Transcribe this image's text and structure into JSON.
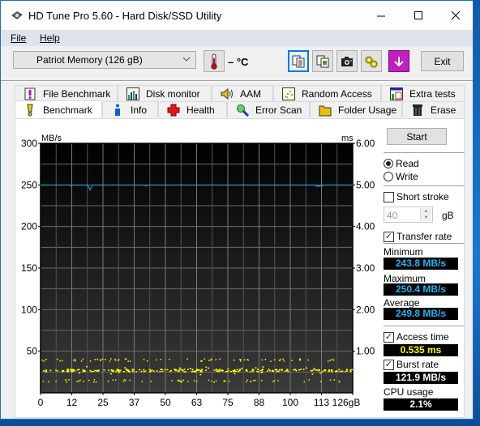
{
  "window": {
    "title": "HD Tune Pro 5.60 - Hard Disk/SSD Utility",
    "controls": {
      "minimize": "minimize-icon",
      "maximize": "maximize-icon",
      "close": "close-icon"
    }
  },
  "menu": [
    {
      "label": "File",
      "accel": "F"
    },
    {
      "label": "Help",
      "accel": "H"
    }
  ],
  "toolbar": {
    "drive": "Patriot Memory (126 gB)",
    "temperature": "– °C",
    "buttons": [
      {
        "name": "copy-text-button",
        "icon": "copy-text-icon"
      },
      {
        "name": "copy-screenshot-button",
        "icon": "copy-image-icon"
      },
      {
        "name": "screenshot-button",
        "icon": "camera-icon"
      },
      {
        "name": "options-button",
        "icon": "gears-icon"
      },
      {
        "name": "save-button",
        "icon": "download-arrow-icon"
      }
    ],
    "exit_label": "Exit"
  },
  "tabs": {
    "top": [
      {
        "label": "File Benchmark",
        "icon": "file-benchmark-icon"
      },
      {
        "label": "Disk monitor",
        "icon": "disk-monitor-icon"
      },
      {
        "label": "AAM",
        "icon": "speaker-icon"
      },
      {
        "label": "Random Access",
        "icon": "random-access-icon"
      },
      {
        "label": "Extra tests",
        "icon": "extra-tests-icon"
      }
    ],
    "bottom": [
      {
        "label": "Benchmark",
        "icon": "exclamation-icon",
        "active": true
      },
      {
        "label": "Info",
        "icon": "info-icon"
      },
      {
        "label": "Health",
        "icon": "health-cross-icon"
      },
      {
        "label": "Error Scan",
        "icon": "magnifier-icon"
      },
      {
        "label": "Folder Usage",
        "icon": "folder-icon"
      },
      {
        "label": "Erase",
        "icon": "trash-icon"
      }
    ]
  },
  "side": {
    "start_label": "Start",
    "read_label": "Read",
    "write_label": "Write",
    "mode": "read",
    "short_stroke_label": "Short stroke",
    "short_stroke_checked": false,
    "short_stroke_value": "40",
    "short_stroke_unit": "gB",
    "transfer_rate_label": "Transfer rate",
    "transfer_rate_checked": true,
    "minimum_label": "Minimum",
    "minimum_value": "243.8 MB/s",
    "maximum_label": "Maximum",
    "maximum_value": "250.4 MB/s",
    "average_label": "Average",
    "average_value": "249.8 MB/s",
    "access_time_label": "Access time",
    "access_time_checked": true,
    "access_time_value": "0.535 ms",
    "burst_rate_label": "Burst rate",
    "burst_rate_checked": true,
    "burst_rate_value": "121.9 MB/s",
    "cpu_label": "CPU usage",
    "cpu_value": "2.1%"
  },
  "colors": {
    "transfer_line": "#1fa8e8",
    "access_dots": "#ffff00",
    "readout_blue": "#1fb4f0"
  },
  "chart_data": {
    "type": "line",
    "title": "",
    "left_unit": "MB/s",
    "right_unit": "ms",
    "xlabel": "gB",
    "x_range": [
      0,
      126
    ],
    "x_ticks": [
      "0",
      "12",
      "25",
      "37",
      "50",
      "63",
      "75",
      "88",
      "100",
      "113",
      "126gB"
    ],
    "y_left_range": [
      0,
      300
    ],
    "y_left_ticks": [
      "50",
      "100",
      "150",
      "200",
      "250",
      "300"
    ],
    "y_right_range": [
      0,
      6
    ],
    "y_right_ticks": [
      "1.00",
      "2.00",
      "3.00",
      "4.00",
      "5.00",
      "6.00"
    ],
    "grid": true,
    "series": [
      {
        "name": "Transfer rate",
        "axis": "left",
        "x": [
          0,
          12,
          12.5,
          13,
          19,
          19.5,
          20,
          20.5,
          21,
          42,
          42.5,
          43,
          111,
          111.5,
          112,
          112.5,
          113,
          113.5,
          114,
          126
        ],
        "values": [
          249.8,
          249.8,
          248.5,
          249.8,
          249.8,
          247,
          243.8,
          247,
          249.8,
          249.8,
          248.8,
          249.8,
          249.8,
          248,
          249.8,
          248,
          249.8,
          248,
          249.8,
          249.8
        ]
      },
      {
        "name": "Access time",
        "axis": "right",
        "type": "scatter",
        "clusters_ms": [
          0.3,
          0.55,
          0.8
        ],
        "average_ms": 0.535
      }
    ]
  }
}
